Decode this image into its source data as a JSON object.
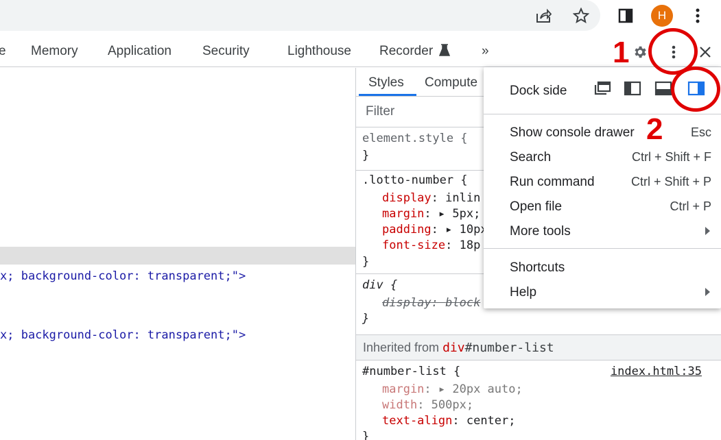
{
  "browser": {
    "avatar_letter": "H",
    "avatar_color": "#e8710a",
    "icons": [
      "share-icon",
      "star-icon",
      "side-panel-icon",
      "kebab-menu-icon"
    ]
  },
  "devtools_tabs": [
    {
      "label": "e"
    },
    {
      "label": "Memory"
    },
    {
      "label": "Application"
    },
    {
      "label": "Security"
    },
    {
      "label": "Lighthouse"
    },
    {
      "label": "Recorder"
    },
    {
      "label": "»"
    }
  ],
  "elements": {
    "line1": {
      "prefix": "x; background-color: transparent;\">"
    },
    "line2": {
      "prefix": "x; background-color: transparent;\">"
    }
  },
  "styles": {
    "tabs": [
      "Styles",
      "Compute"
    ],
    "filter_placeholder": "Filter",
    "element_style_open": "element.style {",
    "close_brace": "}",
    "lotto_selector": ".lotto-number {",
    "lotto_props": [
      {
        "name": "display",
        "sep": ": ",
        "value": "inlin"
      },
      {
        "name": "margin",
        "sep": ": ▸ ",
        "value": "5px;"
      },
      {
        "name": "padding",
        "sep": ": ▸ ",
        "value": "10px"
      },
      {
        "name": "font-size",
        "sep": ": ",
        "value": "18p"
      }
    ],
    "div_selector": "div {",
    "div_prop": {
      "name": "display",
      "sep": ": ",
      "value": "block"
    },
    "inherited_prefix": "Inherited from ",
    "inherited_tag": "div",
    "inherited_id": "#number-list",
    "numlist_selector": "#number-list {",
    "numlist_source": "index.html:35",
    "numlist_props": [
      {
        "name": "margin",
        "sep": ": ▸ ",
        "value": "20px auto;"
      },
      {
        "name": "width",
        "sep": ": ",
        "value": "500px;"
      },
      {
        "name": "text-align",
        "sep": ": ",
        "value": "center;"
      }
    ]
  },
  "menu": {
    "dock_side_label": "Dock side",
    "dock_options": [
      "undock-icon",
      "dock-left-icon",
      "dock-bottom-icon",
      "dock-right-icon"
    ],
    "dock_selected": "dock-right-icon",
    "items": [
      {
        "label": "Show console drawer",
        "shortcut": "Esc"
      },
      {
        "label": "Search",
        "shortcut": "Ctrl + Shift + F"
      },
      {
        "label": "Run command",
        "shortcut": "Ctrl + Shift + P"
      },
      {
        "label": "Open file",
        "shortcut": "Ctrl + P"
      },
      {
        "label": "More tools",
        "submenu": true
      },
      {
        "label": "Shortcuts"
      },
      {
        "label": "Help",
        "submenu": true
      }
    ]
  },
  "annotations": {
    "step1": "1",
    "step2": "2",
    "color": "#e00000"
  }
}
